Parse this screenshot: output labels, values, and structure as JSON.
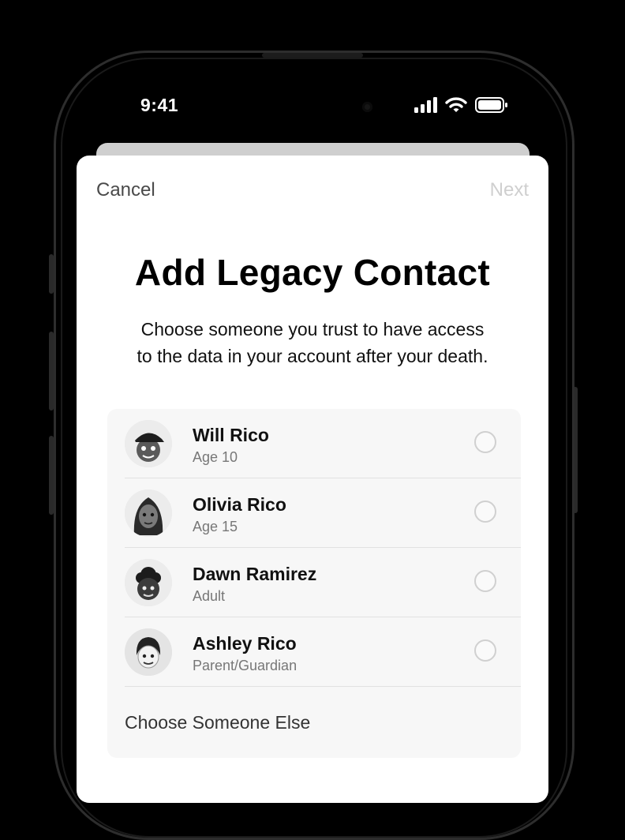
{
  "status_bar": {
    "time": "9:41",
    "icons": [
      "cellular-signal-icon",
      "wifi-icon",
      "battery-icon"
    ]
  },
  "nav": {
    "cancel_label": "Cancel",
    "next_label": "Next"
  },
  "header": {
    "title": "Add Legacy Contact",
    "subtitle_line1": "Choose someone you trust to have access",
    "subtitle_line2": "to the data in your account after your death."
  },
  "contacts": [
    {
      "name": "Will Rico",
      "detail": "Age 10",
      "avatar_icon": "memoji-avatar-icon",
      "selected": false
    },
    {
      "name": "Olivia Rico",
      "detail": "Age 15",
      "avatar_icon": "memoji-avatar-icon",
      "selected": false
    },
    {
      "name": "Dawn Ramirez",
      "detail": "Adult",
      "avatar_icon": "memoji-avatar-icon",
      "selected": false
    },
    {
      "name": "Ashley Rico",
      "detail": "Parent/Guardian",
      "avatar_icon": "memoji-avatar-icon",
      "selected": false
    }
  ],
  "choose_else_label": "Choose Someone Else",
  "colors": {
    "background": "#000000",
    "sheet": "#ffffff",
    "next_disabled": "#cfcfcf",
    "radio_border": "#d0d0d0"
  }
}
